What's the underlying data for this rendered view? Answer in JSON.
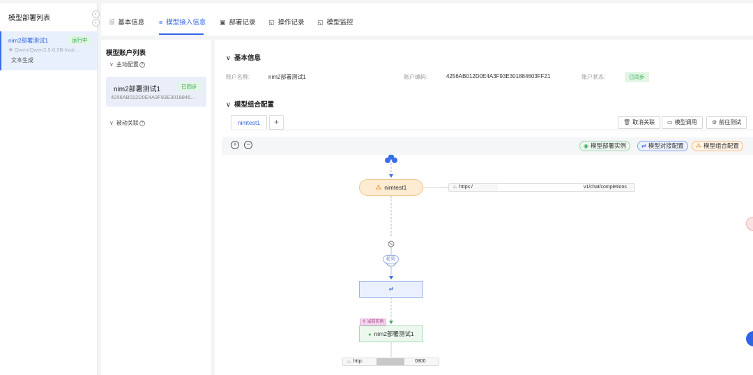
{
  "left_panel": {
    "title": "模型部署列表",
    "collapse_icons": [
      "‹",
      "›"
    ],
    "items": [
      {
        "name": "nim2部署测试1",
        "status": "运行中",
        "model": "Qwen/Qwen2.5-0.5B-Instr...",
        "type": "文本生成"
      }
    ]
  },
  "tabs": [
    {
      "label": "基本信息",
      "icon": "document-icon"
    },
    {
      "label": "模型接入信息",
      "icon": "list-icon",
      "active": true
    },
    {
      "label": "部署记录",
      "icon": "record-icon"
    },
    {
      "label": "操作记录",
      "icon": "operation-log-icon"
    },
    {
      "label": "模型监控",
      "icon": "monitor-icon"
    }
  ],
  "accounts": {
    "title": "模型账户列表",
    "active_group": "主动配置",
    "passive_group": "被动关联",
    "items": [
      {
        "name": "nim2部署测试1",
        "status": "已同步",
        "code": "4256AB012D0E4A3F93E3018846..."
      }
    ]
  },
  "basic_info": {
    "title": "基本信息",
    "account_name_label": "账户名称:",
    "account_name": "nim2部署测试1",
    "account_code_label": "账户编码:",
    "account_code": "4256AB012D0E4A3F93E301884603FF21",
    "account_status_label": "账户状态:",
    "account_status": "已同步"
  },
  "combo_config": {
    "title": "模型组合配置",
    "tab": "nimtest1",
    "add_symbol": "+",
    "buttons": {
      "unlink": "取消关联",
      "invoke": "模型调用",
      "test": "前往测试"
    }
  },
  "legend": {
    "instance": "模型部署实例",
    "docking": "模型对接配置",
    "combo": "模型组合配置"
  },
  "flow": {
    "top_node": "nimtest1",
    "top_url": "https:/",
    "top_url_suffix": "v1/chat/completions",
    "pill": "轮询",
    "minus": "−",
    "current_tag": "当前实例",
    "bottom_node": "nim2部署测试1",
    "bottom_url": "http:",
    "bottom_url_suffix": "0800"
  },
  "colors": {
    "accent": "#2f64e4",
    "success": "#2fa84f",
    "orange": "#e48a2a"
  }
}
